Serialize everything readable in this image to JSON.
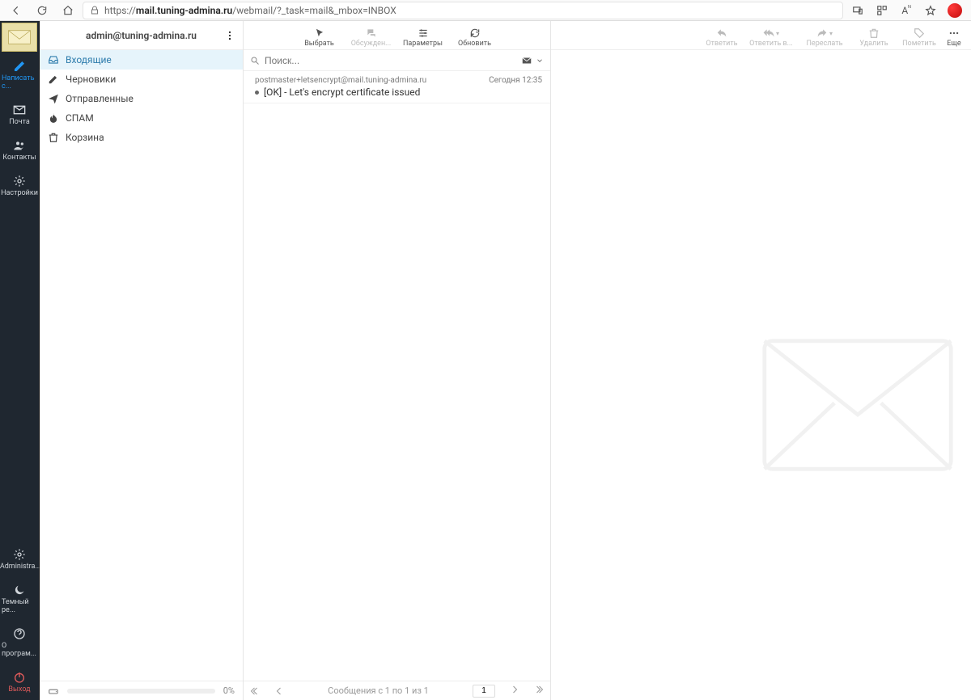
{
  "browser": {
    "url_prefix": "https://",
    "url_host": "mail.tuning-admina.ru",
    "url_path": "/webmail/?_task=mail&_mbox=INBOX"
  },
  "leftnav": {
    "items_top": [
      {
        "key": "compose",
        "label": "Написать с...",
        "active": true
      },
      {
        "key": "mail",
        "label": "Почта",
        "active": false
      },
      {
        "key": "contacts",
        "label": "Контакты",
        "active": false
      },
      {
        "key": "settings",
        "label": "Настройки",
        "active": false
      }
    ],
    "items_bottom": [
      {
        "key": "admin",
        "label": "[Administra..."
      },
      {
        "key": "dark",
        "label": "Темный ре..."
      },
      {
        "key": "about",
        "label": "О програм..."
      },
      {
        "key": "logout",
        "label": "Выход"
      }
    ]
  },
  "account": {
    "email": "admin@tuning-admina.ru"
  },
  "folders": [
    {
      "key": "inbox",
      "label": "Входящие",
      "selected": true
    },
    {
      "key": "drafts",
      "label": "Черновики",
      "selected": false
    },
    {
      "key": "sent",
      "label": "Отправленные",
      "selected": false
    },
    {
      "key": "spam",
      "label": "СПАМ",
      "selected": false
    },
    {
      "key": "trash",
      "label": "Корзина",
      "selected": false
    }
  ],
  "quota": {
    "percent_label": "0%"
  },
  "listToolbar": {
    "select": "Выбрать",
    "threads": "Обсужден...",
    "options": "Параметры",
    "refresh": "Обновить"
  },
  "search": {
    "placeholder": "Поиск..."
  },
  "messages": [
    {
      "from": "postmaster+letsencrypt@mail.tuning-admina.ru",
      "date": "Сегодня 12:35",
      "subject": "[OK] - Let's encrypt certificate issued"
    }
  ],
  "pager": {
    "status": "Сообщения с 1 по 1 из 1",
    "page": "1"
  },
  "msgToolbar": {
    "reply": "Ответить",
    "replyall": "Ответить в...",
    "forward": "Переслать",
    "delete": "Удалить",
    "mark": "Пометить",
    "more": "Еще"
  }
}
